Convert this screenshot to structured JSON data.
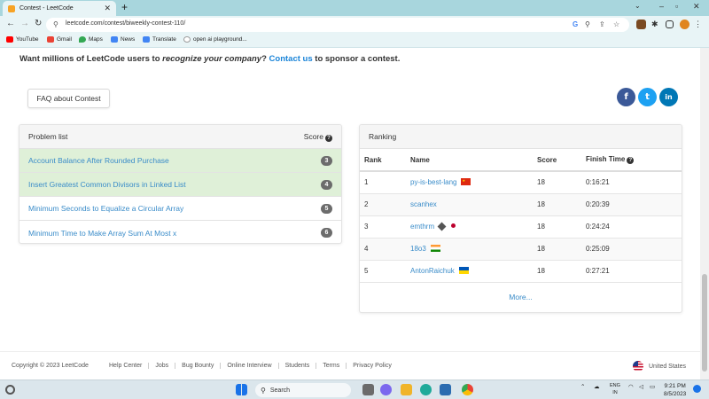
{
  "browser": {
    "tab_title": "Contest - LeetCode",
    "tab_close": "✕",
    "new_tab": "+",
    "url": "leetcode.com/contest/biweekly-contest-110/",
    "bookmarks": [
      "YouTube",
      "Gmail",
      "Maps",
      "News",
      "Translate",
      "open ai playground..."
    ]
  },
  "page": {
    "sponsor_prefix": "Want millions of LeetCode users to ",
    "sponsor_italic": "recognize your company",
    "sponsor_mid": "? ",
    "sponsor_link": "Contact us",
    "sponsor_suffix": " to sponsor a contest.",
    "faq_button": "FAQ about Contest",
    "social": {
      "facebook": "f",
      "twitter": "t",
      "linkedin": "in"
    }
  },
  "problems": {
    "header": "Problem list",
    "score_header": "Score",
    "items": [
      {
        "title": "Account Balance After Rounded Purchase",
        "score": "3",
        "solved": true
      },
      {
        "title": "Insert Greatest Common Divisors in Linked List",
        "score": "4",
        "solved": true
      },
      {
        "title": "Minimum Seconds to Equalize a Circular Array",
        "score": "5",
        "solved": false
      },
      {
        "title": "Minimum Time to Make Array Sum At Most x",
        "score": "6",
        "solved": false
      }
    ]
  },
  "ranking": {
    "header": "Ranking",
    "columns": {
      "rank": "Rank",
      "name": "Name",
      "score": "Score",
      "finish": "Finish Time"
    },
    "rows": [
      {
        "rank": "1",
        "name": "py-is-best-lang",
        "score": "18",
        "finish": "0:16:21",
        "flag": "china-flag"
      },
      {
        "rank": "2",
        "name": "scanhex",
        "score": "18",
        "finish": "0:20:39",
        "flag": ""
      },
      {
        "rank": "3",
        "name": "emthrm",
        "score": "18",
        "finish": "0:24:24",
        "flag": "japan-flag"
      },
      {
        "rank": "4",
        "name": "18o3",
        "score": "18",
        "finish": "0:25:09",
        "flag": "india-flag"
      },
      {
        "rank": "5",
        "name": "AntonRaichuk",
        "score": "18",
        "finish": "0:27:21",
        "flag": "ukraine-flag"
      }
    ],
    "more": "More..."
  },
  "footer": {
    "copyright": "Copyright © 2023 LeetCode",
    "links": [
      "Help Center",
      "Jobs",
      "Bug Bounty",
      "Online Interview",
      "Students",
      "Terms",
      "Privacy Policy"
    ],
    "region": "United States"
  },
  "taskbar": {
    "search": "Search",
    "lang_top": "ENG",
    "lang_bottom": "IN",
    "time": "9:21 PM",
    "date": "8/5/2023"
  }
}
